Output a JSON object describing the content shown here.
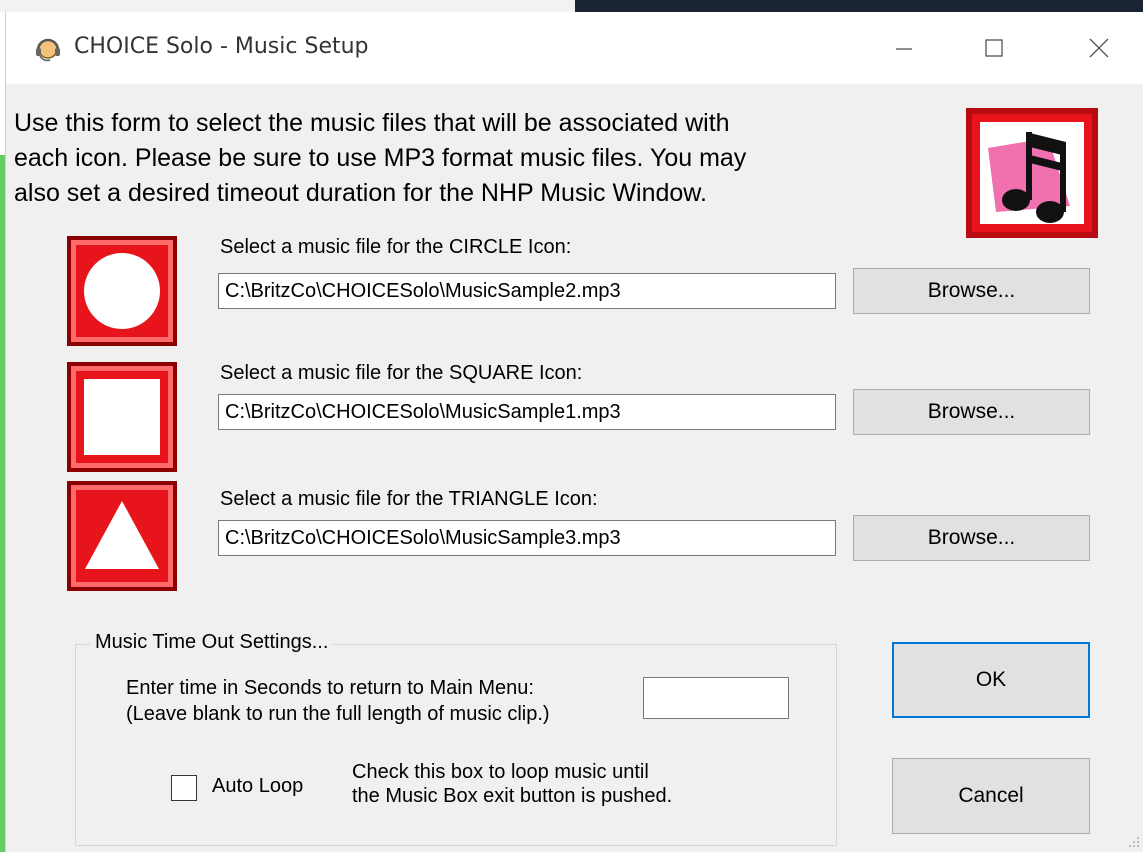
{
  "window": {
    "title": "CHOICE Solo - Music Setup",
    "minimize_glyph": "—",
    "maximize_glyph": "☐",
    "close_glyph": "✕"
  },
  "intro": {
    "text": "Use this form to select the music files that will be associated with\neach icon.  Please be sure to use MP3 format music files.  You may\nalso set a desired timeout duration for the NHP Music Window."
  },
  "rows": [
    {
      "shape": "circle-icon",
      "label": "Select a music file for the CIRCLE Icon:",
      "path": "C:\\BritzCo\\CHOICESolo\\MusicSample2.mp3",
      "browse_label": "Browse..."
    },
    {
      "shape": "square-icon",
      "label": "Select a music file for the SQUARE Icon:",
      "path": "C:\\BritzCo\\CHOICESolo\\MusicSample1.mp3",
      "browse_label": "Browse..."
    },
    {
      "shape": "triangle-icon",
      "label": "Select a music file for the TRIANGLE Icon:",
      "path": "C:\\BritzCo\\CHOICESolo\\MusicSample3.mp3",
      "browse_label": "Browse..."
    }
  ],
  "timeout": {
    "legend": "Music Time Out Settings...",
    "label": "Enter time in Seconds to return to Main Menu:\n(Leave blank to run the full length of music clip.)",
    "value": "",
    "auto_loop_label": "Auto Loop",
    "auto_loop_checked": false,
    "auto_loop_help": "Check this box to loop music until\nthe Music Box exit button is pushed."
  },
  "buttons": {
    "ok": "OK",
    "cancel": "Cancel"
  },
  "colors": {
    "icon_red": "#e8141c",
    "icon_border_dark": "#8b0000",
    "focus_blue": "#0078d7",
    "note_pink": "#f070b0"
  }
}
